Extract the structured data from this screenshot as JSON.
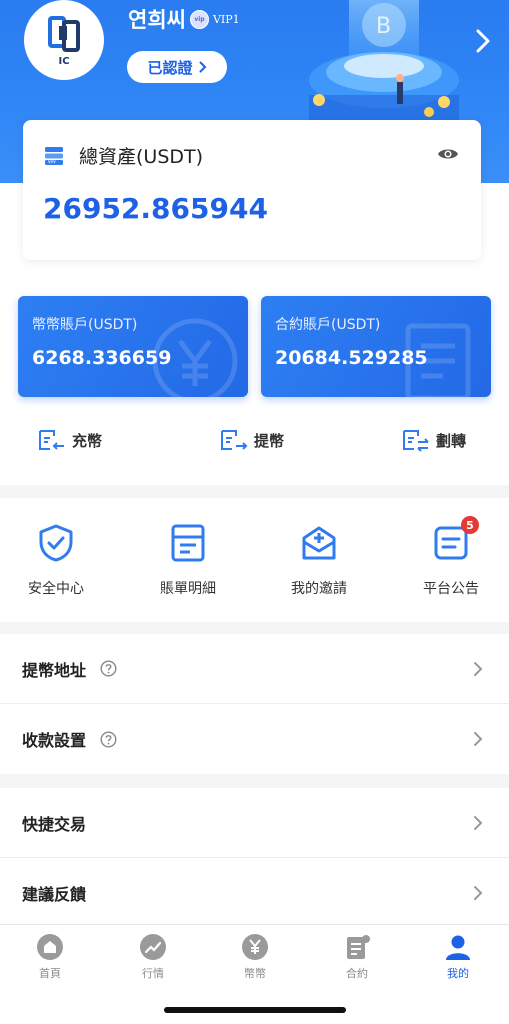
{
  "profile": {
    "username": "연희씨",
    "vip_badge": "vip",
    "vip_level": "VIP1",
    "avatar_text": "IC",
    "verified_label": "已認證"
  },
  "total_assets": {
    "title": "總資產(USDT)",
    "value": "26952.865944"
  },
  "accounts": {
    "spot": {
      "label": "幣幣賬戶(USDT)",
      "value": "6268.336659"
    },
    "contract": {
      "label": "合約賬戶(USDT)",
      "value": "20684.529285"
    }
  },
  "actions": {
    "deposit": "充幣",
    "withdraw": "提幣",
    "transfer": "劃轉"
  },
  "grid_menu": [
    {
      "label": "安全中心",
      "icon": "shield-check-icon"
    },
    {
      "label": "賬單明細",
      "icon": "bill-icon"
    },
    {
      "label": "我的邀請",
      "icon": "envelope-icon"
    },
    {
      "label": "平台公告",
      "icon": "notice-icon",
      "badge": "5"
    }
  ],
  "settings_list": [
    {
      "label": "提幣地址"
    },
    {
      "label": "收款設置"
    }
  ],
  "misc_list": [
    {
      "label": "快捷交易"
    },
    {
      "label": "建議反饋"
    }
  ],
  "tabbar": [
    {
      "label": "首頁",
      "icon": "home-icon"
    },
    {
      "label": "行情",
      "icon": "trend-icon"
    },
    {
      "label": "幣幣",
      "icon": "yen-coin-icon"
    },
    {
      "label": "合約",
      "icon": "contract-icon"
    },
    {
      "label": "我的",
      "icon": "user-icon",
      "active": true
    }
  ],
  "colors": {
    "primary": "#1d62e6",
    "header_bg": "#2f86f5",
    "badge_red": "#e53935",
    "tab_inactive": "#8a8a8a"
  }
}
